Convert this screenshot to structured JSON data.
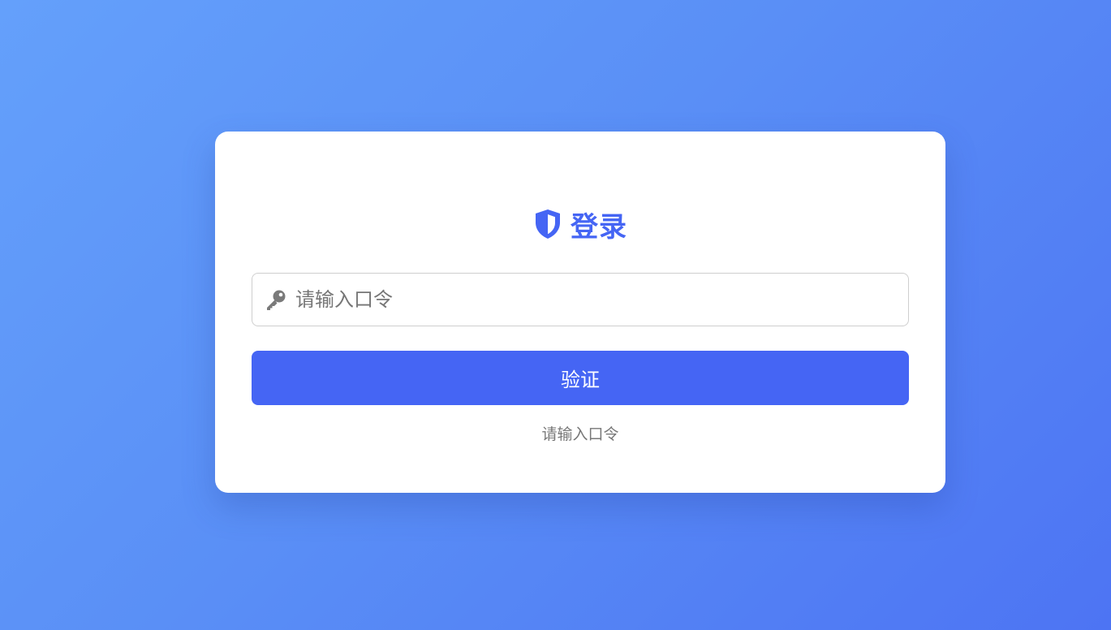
{
  "login": {
    "title": "登录",
    "password_placeholder": "请输入口令",
    "password_value": "",
    "submit_label": "验证",
    "hint": "请输入口令"
  },
  "icons": {
    "title_icon": "shield-icon",
    "input_icon": "key-icon"
  },
  "colors": {
    "accent": "#4565f4",
    "background_start": "#64a0fb",
    "background_end": "#4d74f3",
    "card": "#ffffff",
    "hint_text": "#777777"
  }
}
